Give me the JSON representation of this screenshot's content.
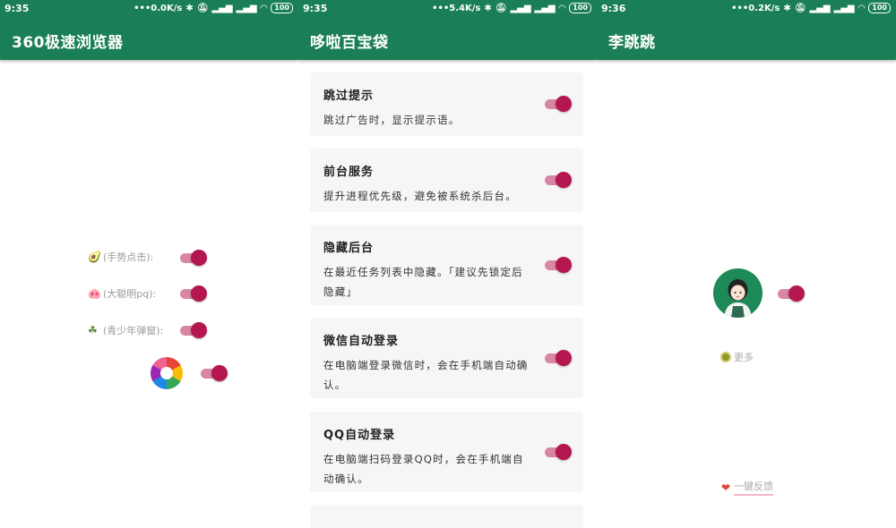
{
  "panels": [
    {
      "time": "9:35",
      "net_speed": "0.0K/s",
      "battery": "100",
      "title": "360极速浏览器",
      "rows": [
        {
          "emoji": "🥑",
          "label": "(手势点击):",
          "on": true
        },
        {
          "emoji": "🐽",
          "label": "(大聪明pq):",
          "on": true
        },
        {
          "emoji": "☘",
          "label": "(青少年弹窗):",
          "on": true
        }
      ],
      "logo_toggle_on": true
    },
    {
      "time": "9:35",
      "net_speed": "5.4K/s",
      "battery": "100",
      "title": "哆啦百宝袋",
      "cards": [
        {
          "title": "跳过提示",
          "desc": "跳过广告时，显示提示语。",
          "on": true
        },
        {
          "title": "前台服务",
          "desc": "提升进程优先级，避免被系统杀后台。",
          "on": true
        },
        {
          "title": "隐藏后台",
          "desc": "在最近任务列表中隐藏。「建议先锁定后隐藏」",
          "on": true
        },
        {
          "title": "微信自动登录",
          "desc": "在电脑端登录微信时，会在手机端自动确认。",
          "on": true
        },
        {
          "title": "QQ自动登录",
          "desc": "在电脑端扫码登录QQ时，会在手机端自动确认。",
          "on": true
        }
      ]
    },
    {
      "time": "9:36",
      "net_speed": "0.2K/s",
      "battery": "100",
      "title": "李跳跳",
      "toggle_on": true,
      "more_label": "更多",
      "feedback_label": "一键反馈"
    }
  ],
  "colors": {
    "appbar": "#1a7f57",
    "toggle_thumb": "#b4164f",
    "toggle_track": "#d886a4",
    "card_bg": "#f6f6f6"
  }
}
